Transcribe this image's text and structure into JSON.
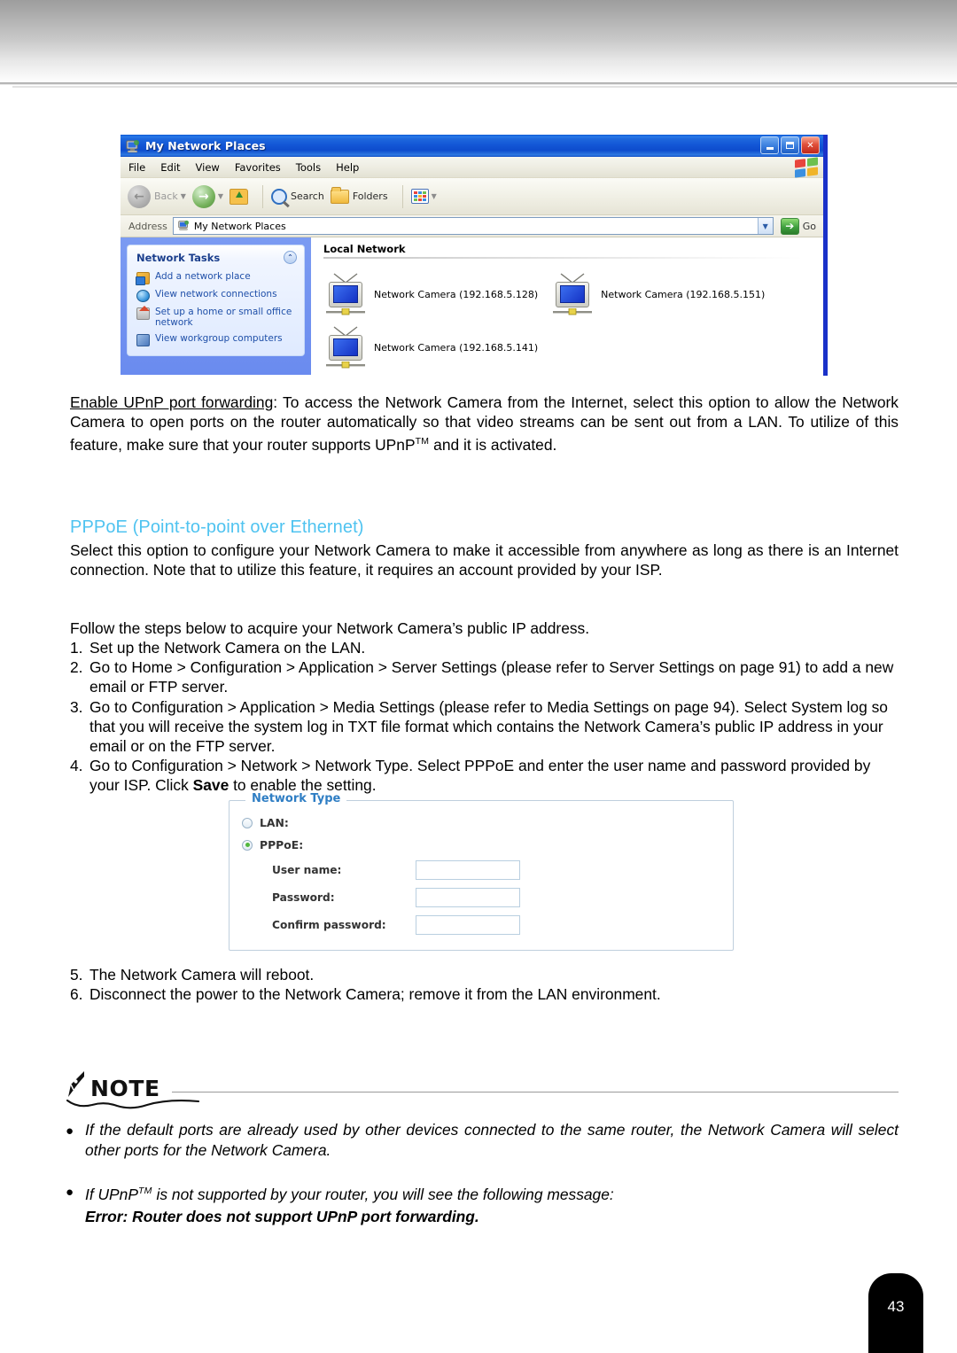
{
  "screenshot": {
    "window_title": "My Network Places",
    "menu": [
      "File",
      "Edit",
      "View",
      "Favorites",
      "Tools",
      "Help"
    ],
    "toolbar": {
      "back_label": "Back",
      "search_label": "Search",
      "folders_label": "Folders"
    },
    "address": {
      "label": "Address",
      "value": "My Network Places",
      "go_label": "Go"
    },
    "tasks_panel": {
      "title": "Network Tasks",
      "items": [
        "Add a network place",
        "View network connections",
        "Set up a home or small office network",
        "View workgroup computers"
      ]
    },
    "content": {
      "group_header": "Local Network",
      "devices": [
        "Network Camera (192.168.5.128)",
        "Network Camera (192.168.5.151)",
        "Network Camera (192.168.5.141)"
      ]
    }
  },
  "upnp_paragraph": {
    "term": "Enable UPnP port forwarding",
    "rest_1": ": To access the Network Camera from the Internet, select this option to allow the Network Camera to open ports on the router automatically so that video streams can be sent out from a LAN. To utilize of this feature, make sure that your router supports UPnP",
    "tm": "TM",
    "rest_2": " and it is activated."
  },
  "pppoe": {
    "heading": "PPPoE (Point-to-point over Ethernet)",
    "intro": "Select this option to configure your Network Camera to make it accessible from anywhere as long as there is an Internet connection. Note that to utilize this feature, it requires an account provided by your ISP.",
    "steps_lead": "Follow the steps below to acquire your Network Camera’s public IP address.",
    "steps": [
      {
        "num": "1.",
        "text": "Set up the Network Camera on the LAN."
      },
      {
        "num": "2.",
        "text": "Go to Home > Configuration > Application > Server Settings (please refer to Server Settings on page 91) to add a new email or FTP server."
      },
      {
        "num": "3.",
        "text": "Go to Configuration > Application > Media Settings (please refer to Media Settings on page 94). Select System log so that you will receive the system log in TXT file format which contains the Network Camera’s public IP address in your email or on the FTP server."
      },
      {
        "num": "4.",
        "text_before": "Go to Configuration > Network > Network Type. Select PPPoE and enter the user name and password provided by your ISP. Click ",
        "bold": "Save",
        "text_after": " to enable the setting."
      },
      {
        "num": "5.",
        "text": "The Network Camera will reboot."
      },
      {
        "num": "6.",
        "text": "Disconnect the power to the Network Camera; remove it from the LAN environment."
      }
    ]
  },
  "network_type_form": {
    "legend": "Network Type",
    "lan_label": "LAN:",
    "lan_selected": false,
    "pppoe_label": "PPPoE:",
    "pppoe_selected": true,
    "fields": [
      {
        "label": "User name:",
        "value": ""
      },
      {
        "label": "Password:",
        "value": ""
      },
      {
        "label": "Confirm password:",
        "value": ""
      }
    ]
  },
  "note": {
    "title": "NOTE",
    "bullet": "●",
    "items": [
      {
        "text": "If the default ports are already used by other devices connected to the same router, the Network Camera will select other ports for the Network Camera."
      },
      {
        "text_before": "If UPnP",
        "tm": "TM",
        "text_after": " is not supported by your router, you will see the following message:",
        "error": "Error: Router does not support UPnP port forwarding."
      }
    ]
  },
  "footer": {
    "page_number": "43"
  },
  "colors": {
    "heading_blue": "#4fc3f0",
    "xp_title_blue": "#1357d6",
    "xp_panel_blue": "#6c8ff0",
    "legend_blue": "#2f7ec4",
    "radio_green": "#52b83e"
  }
}
